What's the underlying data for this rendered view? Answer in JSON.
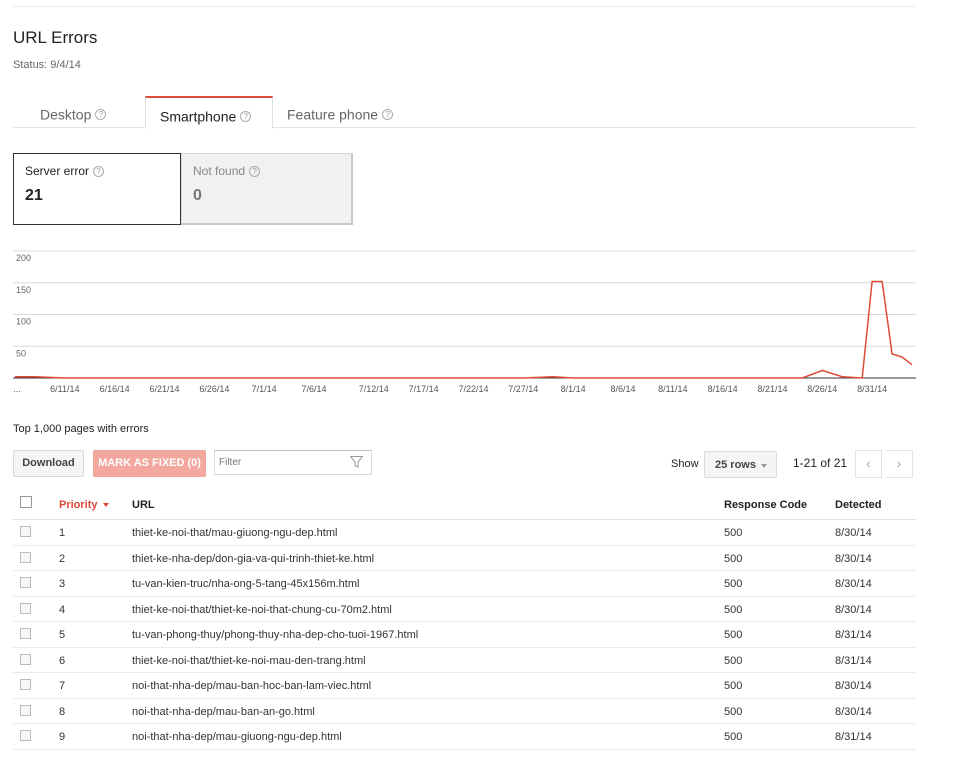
{
  "page": {
    "title": "URL Errors",
    "status": "Status: 9/4/14"
  },
  "tabs": [
    {
      "label": "Desktop",
      "active": false
    },
    {
      "label": "Smartphone",
      "active": true
    },
    {
      "label": "Feature phone",
      "active": false
    }
  ],
  "help_glyph": "?",
  "stats": {
    "server_error": {
      "label": "Server error",
      "value": "21",
      "selected": true
    },
    "not_found": {
      "label": "Not found",
      "value": "0",
      "selected": false
    }
  },
  "chart_data": {
    "type": "line",
    "yticks": [
      50,
      100,
      150,
      200
    ],
    "ylim": [
      0,
      200
    ],
    "xticks": [
      "...",
      "6/11/14",
      "6/16/14",
      "6/21/14",
      "6/26/14",
      "7/1/14",
      "7/6/14",
      "7/12/14",
      "7/17/14",
      "7/22/14",
      "7/27/14",
      "8/1/14",
      "8/6/14",
      "8/11/14",
      "8/16/14",
      "8/21/14",
      "8/26/14",
      "8/31/14"
    ],
    "series": [
      {
        "color": "#dd4b39",
        "points": [
          [
            "6/6/14",
            2
          ],
          [
            "6/8/14",
            2
          ],
          [
            "6/11/14",
            0
          ],
          [
            "7/27/14",
            0
          ],
          [
            "7/30/14",
            2
          ],
          [
            "8/1/14",
            0
          ],
          [
            "8/24/14",
            0
          ],
          [
            "8/26/14",
            12
          ],
          [
            "8/28/14",
            2
          ],
          [
            "8/30/14",
            0
          ],
          [
            "8/31/14",
            152
          ],
          [
            "9/1/14",
            152
          ],
          [
            "9/2/14",
            38
          ],
          [
            "9/3/14",
            33
          ],
          [
            "9/4/14",
            21
          ]
        ]
      }
    ]
  },
  "table": {
    "section_title": "Top 1,000 pages with errors",
    "download_label": "Download",
    "mark_fixed_label": "MARK AS FIXED (0)",
    "filter_placeholder": "Filter",
    "show_label": "Show",
    "rows_select": "25 rows",
    "page_range": "1-21 of 21",
    "prev_glyph": "‹",
    "next_glyph": "›",
    "columns": {
      "priority": "Priority",
      "url": "URL",
      "response_code": "Response Code",
      "detected": "Detected"
    },
    "rows": [
      {
        "priority": "1",
        "url": "thiet-ke-noi-that/mau-giuong-ngu-dep.html",
        "code": "500",
        "detected": "8/30/14"
      },
      {
        "priority": "2",
        "url": "thiet-ke-nha-dep/don-gia-va-qui-trinh-thiet-ke.html",
        "code": "500",
        "detected": "8/30/14"
      },
      {
        "priority": "3",
        "url": "tu-van-kien-truc/nha-ong-5-tang-45x156m.html",
        "code": "500",
        "detected": "8/30/14"
      },
      {
        "priority": "4",
        "url": "thiet-ke-noi-that/thiet-ke-noi-that-chung-cu-70m2.html",
        "code": "500",
        "detected": "8/30/14"
      },
      {
        "priority": "5",
        "url": "tu-van-phong-thuy/phong-thuy-nha-dep-cho-tuoi-1967.html",
        "code": "500",
        "detected": "8/31/14"
      },
      {
        "priority": "6",
        "url": "thiet-ke-noi-that/thiet-ke-noi-mau-den-trang.html",
        "code": "500",
        "detected": "8/31/14"
      },
      {
        "priority": "7",
        "url": "noi-that-nha-dep/mau-ban-hoc-ban-lam-viec.html",
        "code": "500",
        "detected": "8/30/14"
      },
      {
        "priority": "8",
        "url": "noi-that-nha-dep/mau-ban-an-go.html",
        "code": "500",
        "detected": "8/30/14"
      },
      {
        "priority": "9",
        "url": "noi-that-nha-dep/mau-giuong-ngu-dep.html",
        "code": "500",
        "detected": "8/31/14"
      }
    ]
  }
}
